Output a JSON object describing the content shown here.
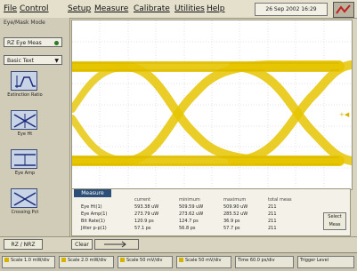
{
  "menu": [
    "File",
    "Control",
    "Setup",
    "Measure",
    "Calibrate",
    "Utilities",
    "Help"
  ],
  "datetime": "26 Sep 2002  16:29",
  "sidebar": {
    "title": "Eye/Mask Mode",
    "combo1": "RZ Eye Meas",
    "combo2": "Basic Text",
    "tiles": [
      "Extinction Ratio",
      "Eye Ht",
      "Eye Amp",
      "Crossing Pct"
    ]
  },
  "measurements": {
    "tab": "Measure",
    "headers": [
      "current",
      "minimum",
      "maximum",
      "total meas"
    ],
    "rows": [
      {
        "label": "Eye Ht(1)",
        "values": [
          "593.38 uW",
          "509.59 uW",
          "509.90 uW",
          "211"
        ]
      },
      {
        "label": "Eye Amp(1)",
        "values": [
          "273.79 uW",
          "273.62 uW",
          "285.52 uW",
          "211"
        ]
      },
      {
        "label": "Bit Rate(1)",
        "values": "['120.9 ps', '124.7 ps', '36.9 ps', '211']",
        "values_list": [
          "120.9 ps",
          "124.7 ps",
          "36.9 ps",
          "211"
        ]
      },
      {
        "label": "Jitter p-p(1)",
        "values_list": [
          "57.1 ps",
          "56.8 ps",
          "57.7 ps",
          "211"
        ]
      }
    ],
    "select_label": "Select Meas"
  },
  "strip": {
    "left_button": "RZ / NRZ",
    "clear_button": "Clear Meas"
  },
  "status_chips": [
    "Scale 1.0 mW/div",
    "Scale 2.0 mW/div",
    "Scale 50 mV/div",
    "Scale 50 mV/div",
    "Time 60.0 ps/div",
    "Trigger Level"
  ],
  "colors": {
    "trace": "#e6c400",
    "trace_dark": "#c9a800",
    "grid": "#b8b8b8",
    "accent": "#2b4f78"
  }
}
